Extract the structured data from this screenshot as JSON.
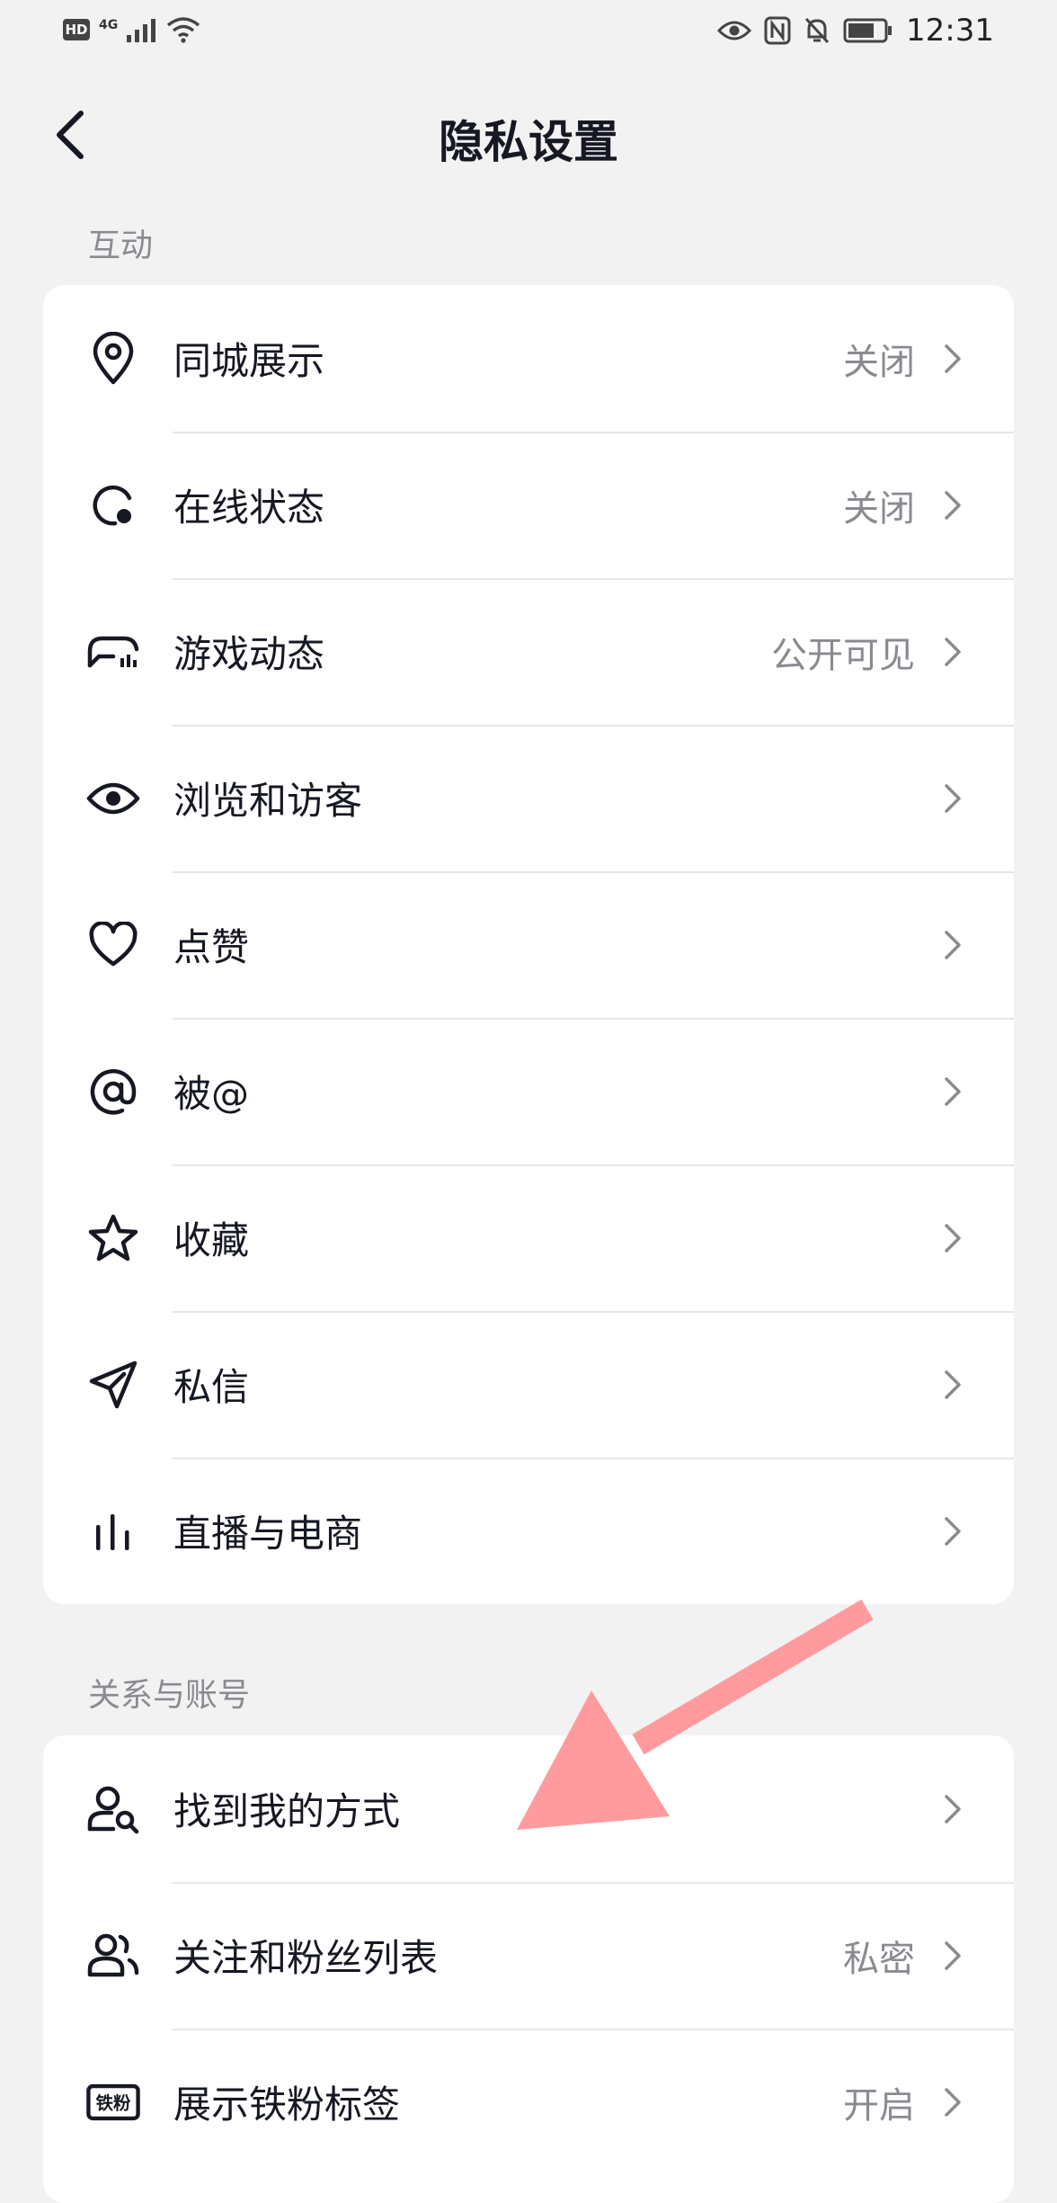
{
  "status_bar": {
    "left_badge": "HD",
    "network": "4G",
    "time": "12:31",
    "icons": [
      "hd-icon",
      "signal-icon",
      "wifi-icon",
      "eye-icon",
      "nfc-icon",
      "mute-icon",
      "battery-icon"
    ]
  },
  "header": {
    "title": "隐私设置",
    "back_icon": "chevron-left-icon"
  },
  "sections": [
    {
      "label": "互动",
      "items": [
        {
          "label": "同城展示",
          "value": "关闭",
          "icon": "location-pin-icon"
        },
        {
          "label": "在线状态",
          "value": "关闭",
          "icon": "online-status-icon"
        },
        {
          "label": "游戏动态",
          "value": "公开可见",
          "icon": "game-controller-icon"
        },
        {
          "label": "浏览和访客",
          "value": "",
          "icon": "eye-icon"
        },
        {
          "label": "点赞",
          "value": "",
          "icon": "heart-icon"
        },
        {
          "label": "被@",
          "value": "",
          "icon": "at-sign-icon"
        },
        {
          "label": "收藏",
          "value": "",
          "icon": "star-icon"
        },
        {
          "label": "私信",
          "value": "",
          "icon": "paper-plane-icon"
        },
        {
          "label": "直播与电商",
          "value": "",
          "icon": "bars-icon"
        }
      ]
    },
    {
      "label": "关系与账号",
      "items": [
        {
          "label": "找到我的方式",
          "value": "",
          "icon": "user-search-icon"
        },
        {
          "label": "关注和粉丝列表",
          "value": "私密",
          "icon": "users-icon"
        },
        {
          "label": "展示铁粉标签",
          "value": "开启",
          "icon": "fan-badge-icon"
        }
      ]
    }
  ],
  "fan_badge_text": "铁粉",
  "colors": {
    "background": "#f2f2f3",
    "card": "#ffffff",
    "text": "#161823",
    "secondary_text": "#8a8b91",
    "annotation_arrow": "#ff9b9e"
  }
}
